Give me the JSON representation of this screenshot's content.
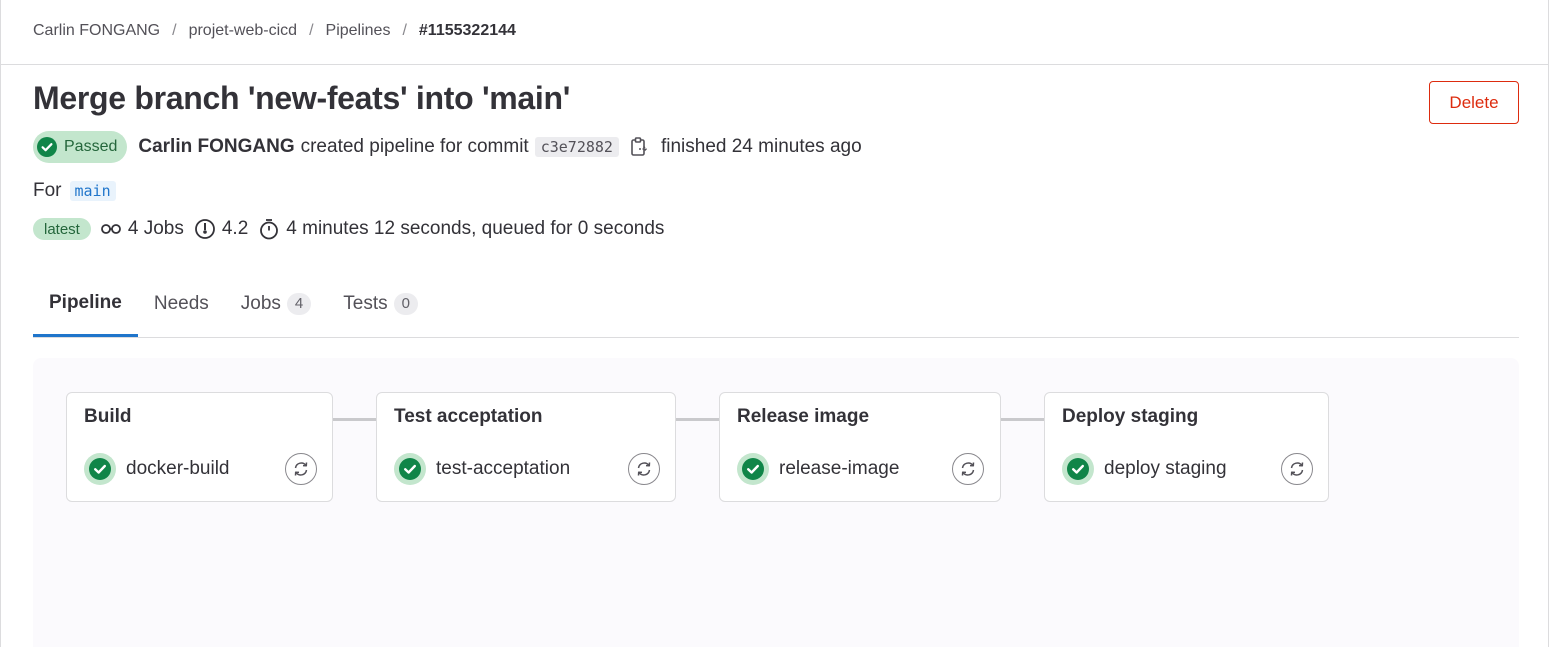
{
  "breadcrumb": {
    "items": [
      "Carlin FONGANG",
      "projet-web-cicd",
      "Pipelines",
      "#1155322144"
    ],
    "separator": "/"
  },
  "header": {
    "title": "Merge branch 'new-feats' into 'main'",
    "delete_label": "Delete"
  },
  "status": {
    "badge_label": "Passed",
    "author": "Carlin FONGANG",
    "action_text": "created pipeline for commit",
    "commit_sha": "c3e72882",
    "finished_text": "finished 24 minutes ago"
  },
  "ref": {
    "prefix": "For",
    "branch": "main"
  },
  "meta": {
    "latest_label": "latest",
    "jobs_text": "4 Jobs",
    "compute_text": "4.2",
    "duration_text": "4 minutes 12 seconds, queued for 0 seconds"
  },
  "tabs": [
    {
      "label": "Pipeline",
      "count": null
    },
    {
      "label": "Needs",
      "count": null
    },
    {
      "label": "Jobs",
      "count": "4"
    },
    {
      "label": "Tests",
      "count": "0"
    }
  ],
  "stages": [
    {
      "title": "Build",
      "job": "docker-build"
    },
    {
      "title": "Test acceptation",
      "job": "test-acceptation"
    },
    {
      "title": "Release image",
      "job": "release-image"
    },
    {
      "title": "Deploy staging",
      "job": "deploy staging"
    }
  ],
  "colors": {
    "success": "#108548",
    "success_bg": "#c3e6cd",
    "danger": "#dd2b0e",
    "link_blue": "#1f75cb"
  }
}
